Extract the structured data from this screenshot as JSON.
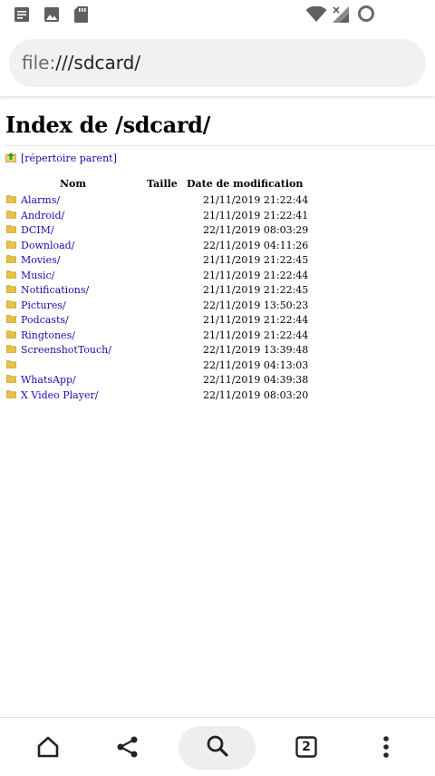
{
  "url": {
    "scheme": "file:",
    "path": "///sdcard/"
  },
  "page": {
    "title": "Index de /sdcard/",
    "parent_link": "[répertoire parent]"
  },
  "table": {
    "headers": {
      "name": "Nom",
      "size": "Taille",
      "date": "Date de modification"
    },
    "rows": [
      {
        "name": "Alarms/",
        "date": "21/11/2019 21:22:44"
      },
      {
        "name": "Android/",
        "date": "21/11/2019 21:22:41"
      },
      {
        "name": "DCIM/",
        "date": "22/11/2019 08:03:29"
      },
      {
        "name": "Download/",
        "date": "22/11/2019 04:11:26"
      },
      {
        "name": "Movies/",
        "date": "21/11/2019 21:22:45"
      },
      {
        "name": "Music/",
        "date": "21/11/2019 21:22:44"
      },
      {
        "name": "Notifications/",
        "date": "21/11/2019 21:22:45"
      },
      {
        "name": "Pictures/",
        "date": "22/11/2019 13:50:23"
      },
      {
        "name": "Podcasts/",
        "date": "21/11/2019 21:22:44"
      },
      {
        "name": "Ringtones/",
        "date": "21/11/2019 21:22:44"
      },
      {
        "name": "ScreenshotTouch/",
        "date": "22/11/2019 13:39:48"
      },
      {
        "name": "",
        "date": "22/11/2019 04:13:03"
      },
      {
        "name": "WhatsApp/",
        "date": "22/11/2019 04:39:38"
      },
      {
        "name": "X Video Player/",
        "date": "22/11/2019 08:03:20"
      }
    ]
  },
  "bottom_nav": {
    "tab_count": "2"
  },
  "icons": {
    "status_left": [
      "notes-icon",
      "image-icon",
      "sd-card-icon"
    ],
    "status_right": [
      "wifi-icon",
      "signal-no-service-icon",
      "battery-ring-icon"
    ],
    "nav": [
      "home-icon",
      "share-icon",
      "search-icon",
      "tabs-icon",
      "more-vert-icon"
    ]
  },
  "colors": {
    "link": "#1a0dab",
    "folder": "#e8c240",
    "url_bar_bg": "#f1f1f1"
  }
}
